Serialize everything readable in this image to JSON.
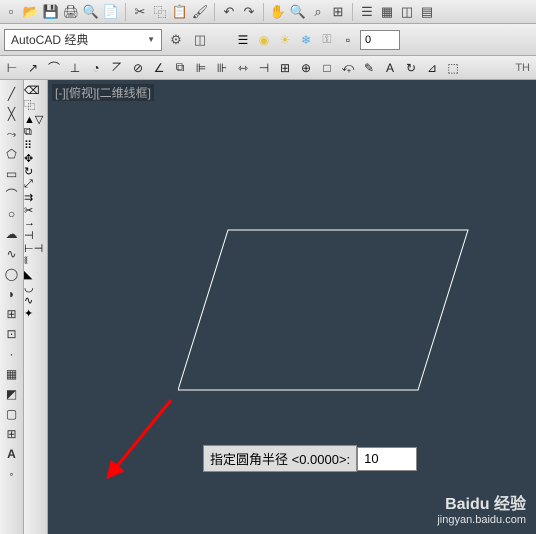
{
  "workspace": {
    "label": "AutoCAD 经典"
  },
  "layer": {
    "value": "0"
  },
  "view": {
    "label": "[-][俯视][二维线框]"
  },
  "prompt": {
    "label": "指定圆角半径 <0.0000>:",
    "value": "10"
  },
  "watermark": {
    "brand": "Baidu 经验",
    "url": "jingyan.baidu.com"
  },
  "toolbar_end": "TH"
}
